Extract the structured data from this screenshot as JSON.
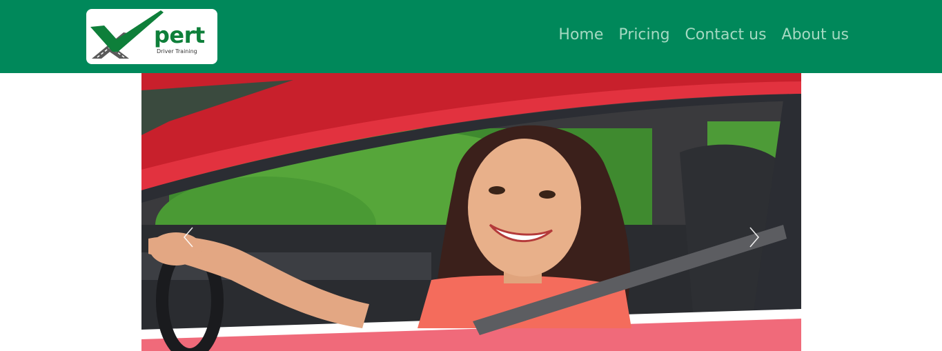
{
  "brand": {
    "name": "pert",
    "tagline": "Driver Training",
    "primary_color": "#00885a",
    "logo_green": "#0e7f3a",
    "logo_gray": "#5a5a5a"
  },
  "nav": {
    "items": [
      {
        "label": "Home"
      },
      {
        "label": "Pricing"
      },
      {
        "label": "Contact us"
      },
      {
        "label": "About us"
      }
    ],
    "link_color": "#a5d9c2"
  },
  "carousel": {
    "image": "smiling-woman-driving-red-car",
    "prev_icon": "chevron-left-icon",
    "next_icon": "chevron-right-icon"
  }
}
